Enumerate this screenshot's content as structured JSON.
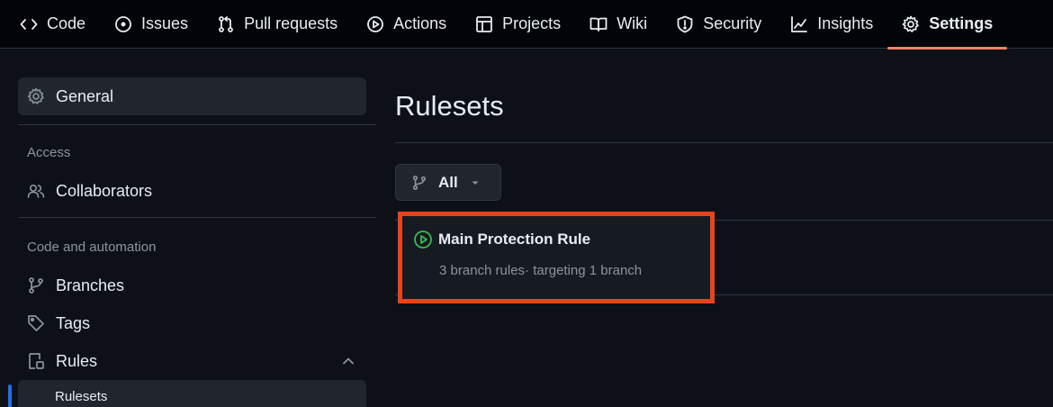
{
  "nav": {
    "tabs": [
      {
        "label": "Code",
        "icon": "code-icon"
      },
      {
        "label": "Issues",
        "icon": "issue-icon"
      },
      {
        "label": "Pull requests",
        "icon": "pull-request-icon"
      },
      {
        "label": "Actions",
        "icon": "play-icon"
      },
      {
        "label": "Projects",
        "icon": "table-icon"
      },
      {
        "label": "Wiki",
        "icon": "book-icon"
      },
      {
        "label": "Security",
        "icon": "shield-icon"
      },
      {
        "label": "Insights",
        "icon": "graph-icon"
      },
      {
        "label": "Settings",
        "icon": "gear-icon",
        "active": true
      }
    ],
    "active_underline_color": "#f78166"
  },
  "sidebar": {
    "general_label": "General",
    "access_heading": "Access",
    "collaborators_label": "Collaborators",
    "code_automation_heading": "Code and automation",
    "branches_label": "Branches",
    "tags_label": "Tags",
    "rules_label": "Rules",
    "rulesets_label": "Rulesets"
  },
  "main": {
    "title": "Rulesets",
    "filter_label": "All",
    "rules": [
      {
        "name": "Main Protection Rule",
        "meta": "3 branch rules· targeting 1 branch",
        "status_color": "#3fb950"
      }
    ],
    "highlight_color": "#e8431f"
  }
}
